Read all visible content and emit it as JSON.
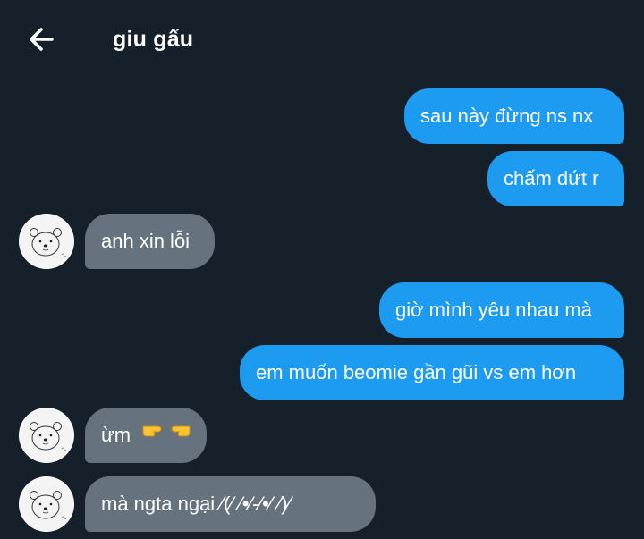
{
  "header": {
    "title": "giu gấu",
    "back_icon": "arrow-left-icon"
  },
  "colors": {
    "background": "#15202b",
    "sent_bubble": "#1d9bf0",
    "received_bubble": "#66737f",
    "text": "#ffffff"
  },
  "messages": [
    {
      "from": "me",
      "text": "sau này đừng ns nx"
    },
    {
      "from": "me",
      "text": "chấm dứt r"
    },
    {
      "from": "them",
      "text": "anh xin lỗi"
    },
    {
      "from": "me",
      "text": "giờ mình yêu nhau mà"
    },
    {
      "from": "me",
      "text": "em muốn beomie gần gũi vs em hơn"
    },
    {
      "from": "them",
      "text": "ừm",
      "emoji": [
        "👉",
        "👈"
      ],
      "emoji_icon": "pointing-fingers-icon"
    },
    {
      "from": "them",
      "text": "mà ngta ngại ⁄(⁄ ⁄•⁄-⁄•⁄ ⁄)⁄"
    }
  ],
  "avatar": {
    "icon": "bear-face-icon"
  }
}
